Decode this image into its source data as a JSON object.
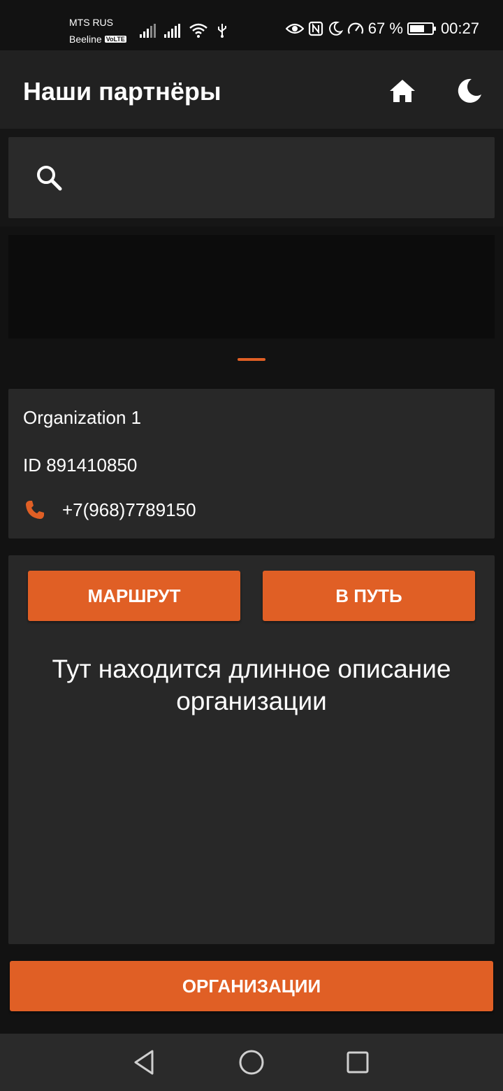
{
  "status_bar": {
    "carrier_1": "MTS RUS",
    "carrier_2": "Beeline",
    "volte": "VoLTE",
    "battery_percent": "67 %",
    "battery_level": 0.67,
    "time": "00:27"
  },
  "app_bar": {
    "title": "Наши партнёры",
    "home_icon": "home-icon",
    "theme_icon": "moon-icon"
  },
  "search": {
    "icon": "search-icon",
    "value": "",
    "placeholder": ""
  },
  "organization": {
    "name": "Organization 1",
    "id_text": "ID 891410850",
    "phone": "+7(968)7789150"
  },
  "actions": {
    "route_label": "МАРШРУТ",
    "go_label": "В ПУТЬ"
  },
  "description": "Тут находится длинное описание организации",
  "footer": {
    "organizations_label": "ОРГАНИЗАЦИИ"
  },
  "colors": {
    "accent": "#e05f25",
    "surface": "#282828",
    "background": "#121212",
    "app_bar": "#212121"
  }
}
